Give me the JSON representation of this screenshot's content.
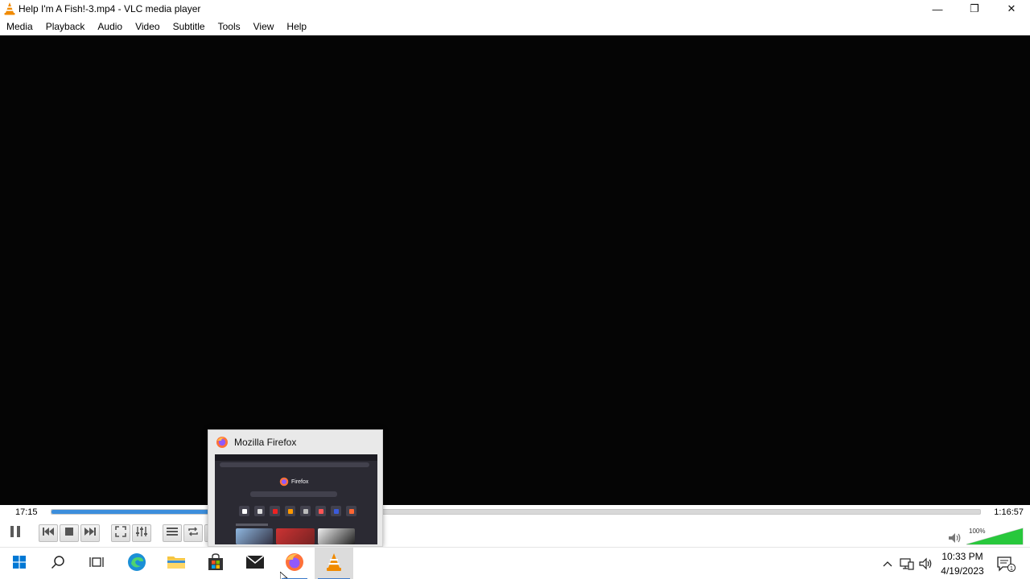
{
  "window": {
    "title": "Help I'm A Fish!-3.mp4 - VLC media player",
    "minimize_glyph": "—",
    "maximize_glyph": "❐",
    "close_glyph": "✕"
  },
  "menu": [
    "Media",
    "Playback",
    "Audio",
    "Video",
    "Subtitle",
    "Tools",
    "View",
    "Help"
  ],
  "player": {
    "elapsed": "17:15",
    "total": "1:16:57",
    "progress_fraction": 0.225,
    "volume_label": "100%",
    "volume_fraction": 1.0
  },
  "taskbar": {
    "items": [
      "start-button",
      "search-button",
      "task-view-button",
      "edge-app",
      "file-explorer-app",
      "microsoft-store-app",
      "mail-app",
      "firefox-app",
      "vlc-app"
    ],
    "clock_time": "10:33 PM",
    "clock_date": "4/19/2023",
    "notification_count": "1"
  },
  "thumbnail": {
    "title": "Mozilla Firefox",
    "preview_logo_text": "Firefox"
  },
  "colors": {
    "seek_fill": "#3c8edc",
    "vlc_orange": "#f08a00",
    "taskbar_accent": "#3b79c9",
    "volume_green": "#28c83c"
  }
}
